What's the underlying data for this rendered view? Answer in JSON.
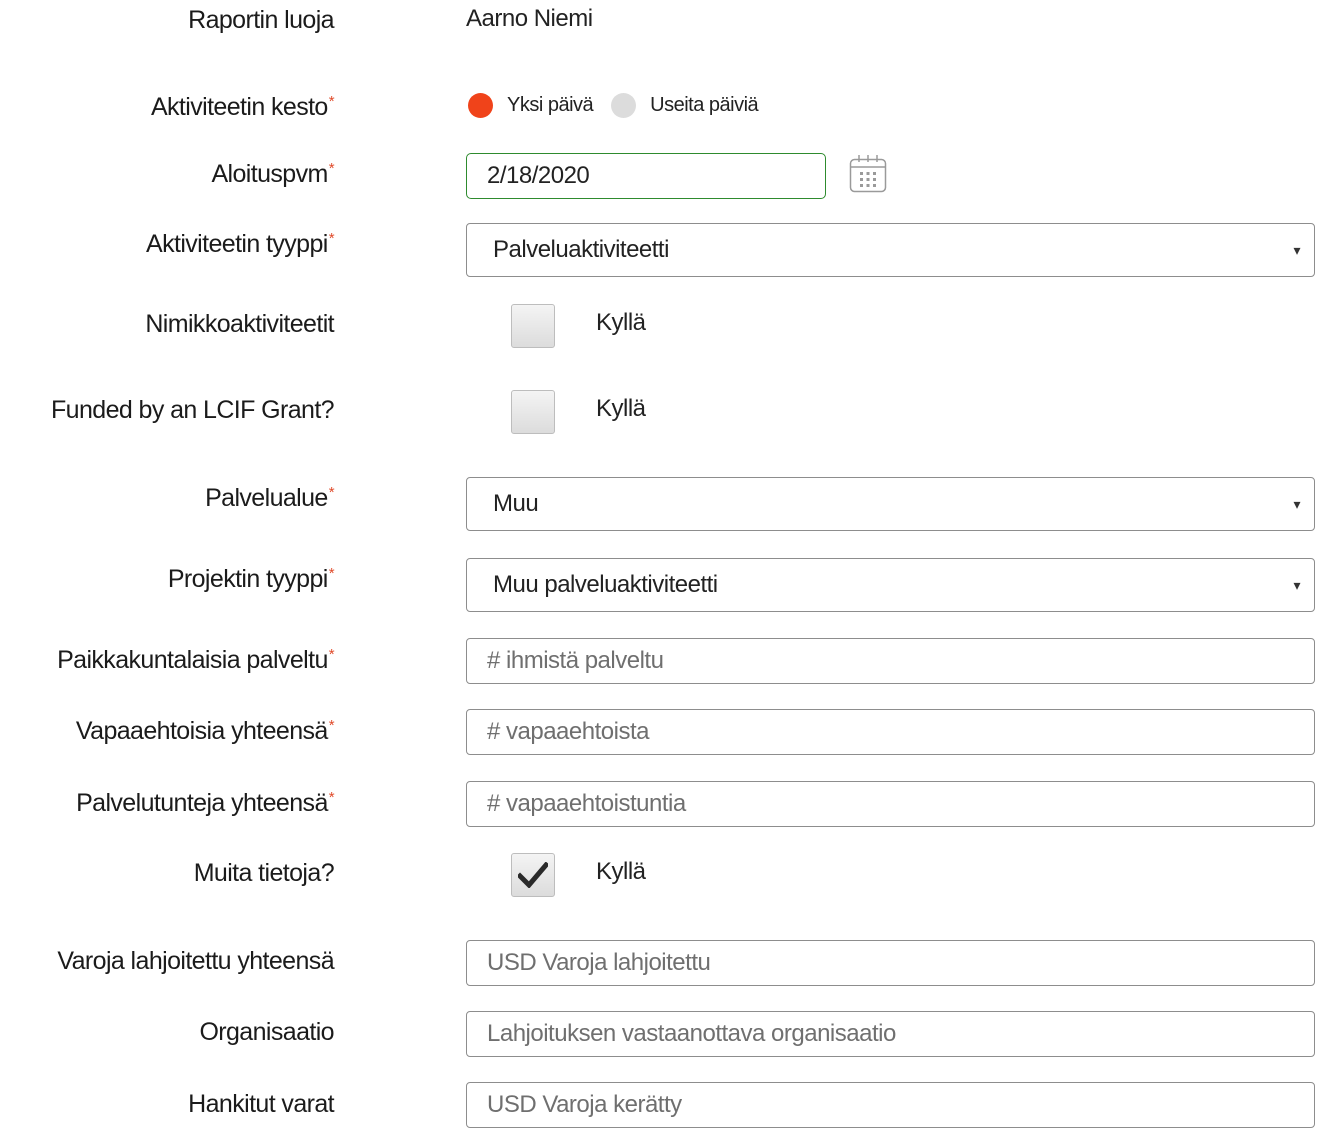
{
  "fields": {
    "creator": {
      "label": "Raportin luoja",
      "value": "Aarno Niemi"
    },
    "duration": {
      "label": "Aktiviteetin kesto",
      "required_mark": "*",
      "options": [
        {
          "label": "Yksi päivä",
          "selected": true
        },
        {
          "label": "Useita päiviä",
          "selected": false
        }
      ]
    },
    "start_date": {
      "label": "Aloituspvm",
      "required_mark": "*",
      "value": "2/18/2020",
      "icon": "calendar-icon"
    },
    "activity_type": {
      "label": "Aktiviteetin tyyppi",
      "required_mark": "*",
      "value": "Palveluaktiviteetti"
    },
    "signature_activities": {
      "label": "Nimikkoaktiviteetit",
      "checkbox_label": "Kyllä",
      "checked": false
    },
    "lcif_grant": {
      "label": "Funded by an LCIF Grant?",
      "checkbox_label": "Kyllä",
      "checked": false
    },
    "service_area": {
      "label": "Palvelualue",
      "required_mark": "*",
      "value": "Muu"
    },
    "project_type": {
      "label": "Projektin tyyppi",
      "required_mark": "*",
      "value": "Muu palveluaktiviteetti"
    },
    "people_served": {
      "label": "Paikkakuntalaisia palveltu",
      "required_mark": "*",
      "placeholder": "# ihmistä palveltu",
      "value": ""
    },
    "volunteers": {
      "label": "Vapaaehtoisia yhteensä",
      "required_mark": "*",
      "placeholder": "# vapaaehtoista",
      "value": ""
    },
    "service_hours": {
      "label": "Palvelutunteja yhteensä",
      "required_mark": "*",
      "placeholder": "# vapaaehtoistuntia",
      "value": ""
    },
    "more_info": {
      "label": "Muita tietoja?",
      "checkbox_label": "Kyllä",
      "checked": true
    },
    "funds_donated": {
      "label": "Varoja lahjoitettu yhteensä",
      "placeholder": "USD Varoja lahjoitettu",
      "value": ""
    },
    "organization": {
      "label": "Organisaatio",
      "placeholder": "Lahjoituksen vastaanottava organisaatio",
      "value": ""
    },
    "funds_raised": {
      "label": "Hankitut varat",
      "placeholder": "USD Varoja kerätty",
      "value": ""
    }
  },
  "colors": {
    "accent": "#f0431a",
    "required": "#e04a2a",
    "date_border": "#2e8b2e"
  },
  "icons": {
    "select_arrow": "▾"
  }
}
